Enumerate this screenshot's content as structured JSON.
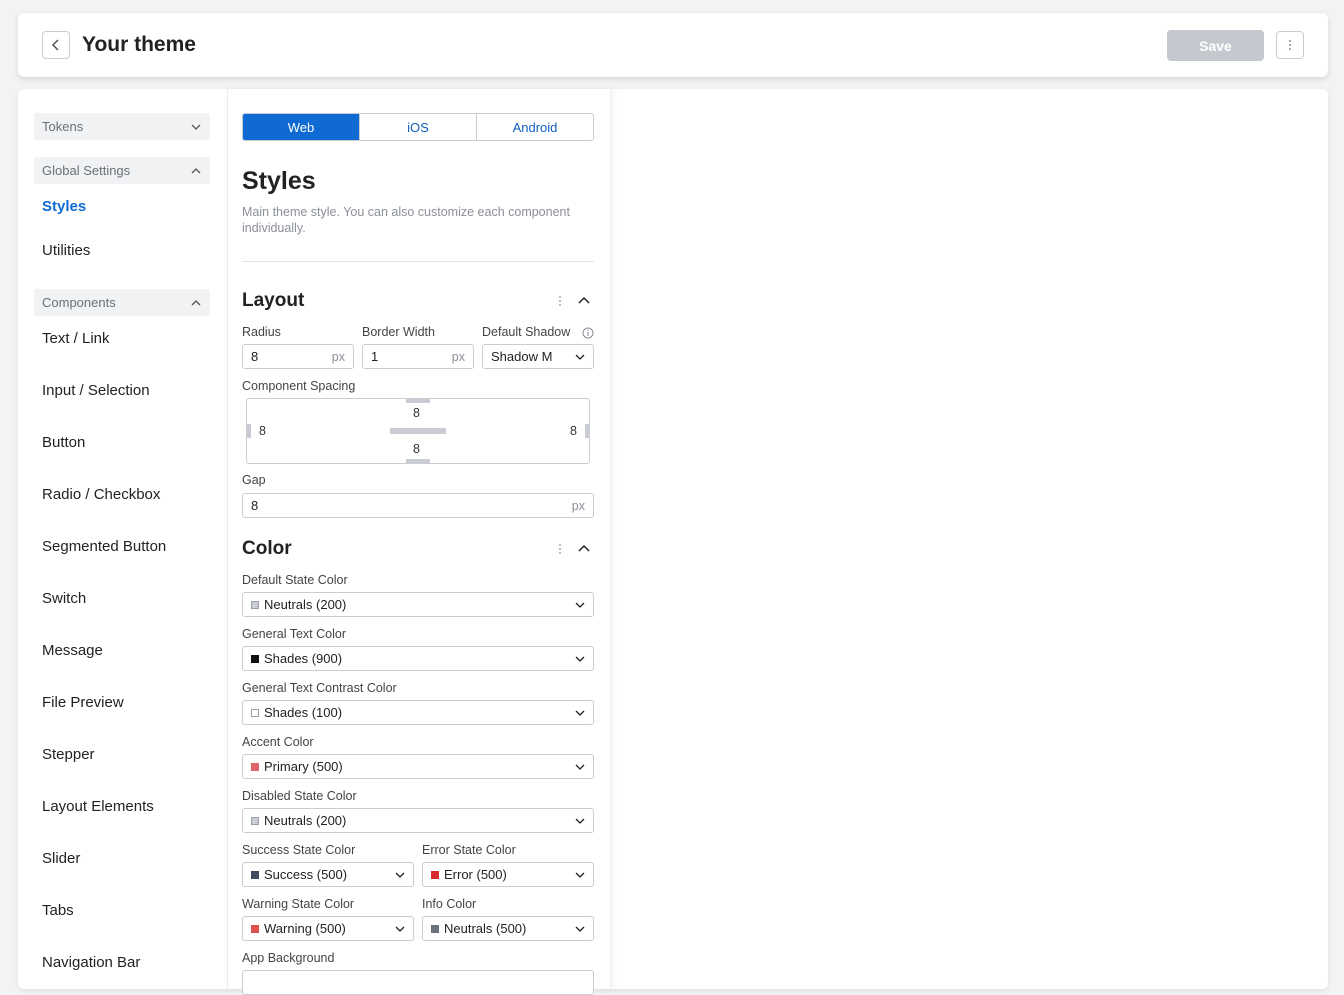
{
  "header": {
    "title": "Your theme",
    "save_label": "Save"
  },
  "sidebar": {
    "tokens_label": "Tokens",
    "global_settings_label": "Global Settings",
    "global_items": [
      "Styles",
      "Utilities"
    ],
    "components_label": "Components",
    "component_items": [
      "Text / Link",
      "Input / Selection",
      "Button",
      "Radio / Checkbox",
      "Segmented Button",
      "Switch",
      "Message",
      "File Preview",
      "Stepper",
      "Layout Elements",
      "Slider",
      "Tabs",
      "Navigation Bar"
    ]
  },
  "platform_tabs": [
    "Web",
    "iOS",
    "Android"
  ],
  "active_tab": "Web",
  "styles": {
    "title": "Styles",
    "description": "Main theme style. You can also customize each component individually."
  },
  "layout": {
    "title": "Layout",
    "radius_label": "Radius",
    "radius_value": "8",
    "radius_unit": "px",
    "border_width_label": "Border Width",
    "border_width_value": "1",
    "border_width_unit": "px",
    "default_shadow_label": "Default Shadow",
    "default_shadow_value": "Shadow M",
    "component_spacing_label": "Component Spacing",
    "spacing_top": "8",
    "spacing_left": "8",
    "spacing_right": "8",
    "spacing_bottom": "8",
    "gap_label": "Gap",
    "gap_value": "8",
    "gap_unit": "px"
  },
  "color": {
    "title": "Color",
    "default_state_label": "Default State Color",
    "default_state_value": "Neutrals (200)",
    "general_text_label": "General Text Color",
    "general_text_value": "Shades (900)",
    "general_text_contrast_label": "General Text Contrast Color",
    "general_text_contrast_value": "Shades (100)",
    "accent_label": "Accent Color",
    "accent_value": "Primary (500)",
    "disabled_state_label": "Disabled State Color",
    "disabled_state_value": "Neutrals (200)",
    "success_state_label": "Success State Color",
    "success_state_value": "Success (500)",
    "error_state_label": "Error State Color",
    "error_state_value": "Error (500)",
    "warning_state_label": "Warning State Color",
    "warning_state_value": "Warning (500)",
    "info_label": "Info Color",
    "info_value": "Neutrals (500)",
    "app_background_label": "App Background"
  },
  "colors": {
    "accent_blue": "#0f6bd3",
    "swatch_neutrals_200": "#c9ccd2",
    "swatch_shades_900": "#111111",
    "swatch_shades_100": "#ffffff",
    "swatch_primary_500": "#e06666",
    "swatch_success_500": "#3f4a5c",
    "swatch_error_500": "#d92b2b",
    "swatch_warning_500": "#e05050",
    "swatch_neutrals_500": "#6b7282",
    "save_disabled": "#c5c8ce"
  },
  "icons": {
    "back": "chevron-left-icon",
    "more": "vertical-dots-icon",
    "chevron_down": "chevron-down-icon",
    "chevron_up": "chevron-up-icon",
    "info": "info-icon"
  }
}
